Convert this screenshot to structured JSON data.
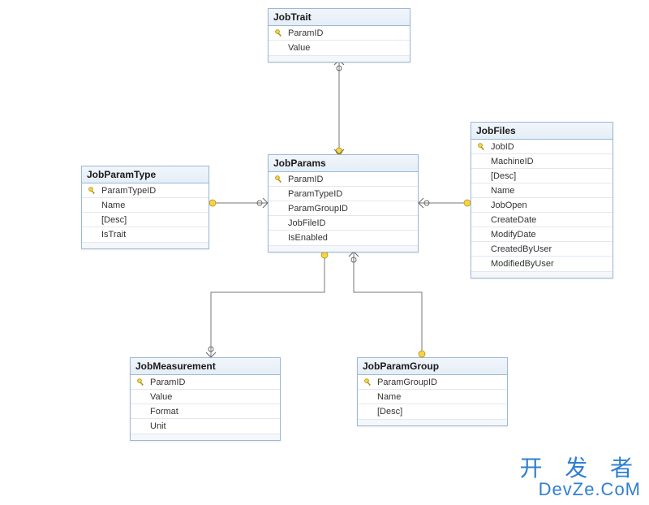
{
  "diagram": {
    "type": "entity-relationship",
    "tables": {
      "jobtrait": {
        "title": "JobTrait",
        "columns": [
          {
            "name": "ParamID",
            "pk": true
          },
          {
            "name": "Value",
            "pk": false
          }
        ]
      },
      "jobparamtype": {
        "title": "JobParamType",
        "columns": [
          {
            "name": "ParamTypeID",
            "pk": true
          },
          {
            "name": "Name",
            "pk": false
          },
          {
            "name": "[Desc]",
            "pk": false
          },
          {
            "name": "IsTrait",
            "pk": false
          }
        ]
      },
      "jobparams": {
        "title": "JobParams",
        "columns": [
          {
            "name": "ParamID",
            "pk": true
          },
          {
            "name": "ParamTypeID",
            "pk": false
          },
          {
            "name": "ParamGroupID",
            "pk": false
          },
          {
            "name": "JobFileID",
            "pk": false
          },
          {
            "name": "IsEnabled",
            "pk": false
          }
        ]
      },
      "jobfiles": {
        "title": "JobFiles",
        "columns": [
          {
            "name": "JobID",
            "pk": true
          },
          {
            "name": "MachineID",
            "pk": false
          },
          {
            "name": "[Desc]",
            "pk": false
          },
          {
            "name": "Name",
            "pk": false
          },
          {
            "name": "JobOpen",
            "pk": false
          },
          {
            "name": "CreateDate",
            "pk": false
          },
          {
            "name": "ModifyDate",
            "pk": false
          },
          {
            "name": "CreatedByUser",
            "pk": false
          },
          {
            "name": "ModifiedByUser",
            "pk": false
          }
        ]
      },
      "jobmeasurement": {
        "title": "JobMeasurement",
        "columns": [
          {
            "name": "ParamID",
            "pk": true
          },
          {
            "name": "Value",
            "pk": false
          },
          {
            "name": "Format",
            "pk": false
          },
          {
            "name": "Unit",
            "pk": false
          }
        ]
      },
      "jobparamgroup": {
        "title": "JobParamGroup",
        "columns": [
          {
            "name": "ParamGroupID",
            "pk": true
          },
          {
            "name": "Name",
            "pk": false
          },
          {
            "name": "[Desc]",
            "pk": false
          }
        ]
      }
    },
    "relationships": [
      {
        "from": "jobtrait",
        "to": "jobparams",
        "from_end": "fk-many",
        "to_end": "pk-one"
      },
      {
        "from": "jobparamtype",
        "to": "jobparams",
        "from_end": "pk-one",
        "to_end": "fk-many"
      },
      {
        "from": "jobfiles",
        "to": "jobparams",
        "from_end": "pk-one",
        "to_end": "fk-many"
      },
      {
        "from": "jobmeasurement",
        "to": "jobparams",
        "from_end": "fk-many",
        "to_end": "pk-one"
      },
      {
        "from": "jobparamgroup",
        "to": "jobparams",
        "from_end": "pk-one",
        "to_end": "fk-many"
      }
    ]
  },
  "watermark": {
    "line1": "开 发 者",
    "line2": "DevZe.CoM"
  }
}
